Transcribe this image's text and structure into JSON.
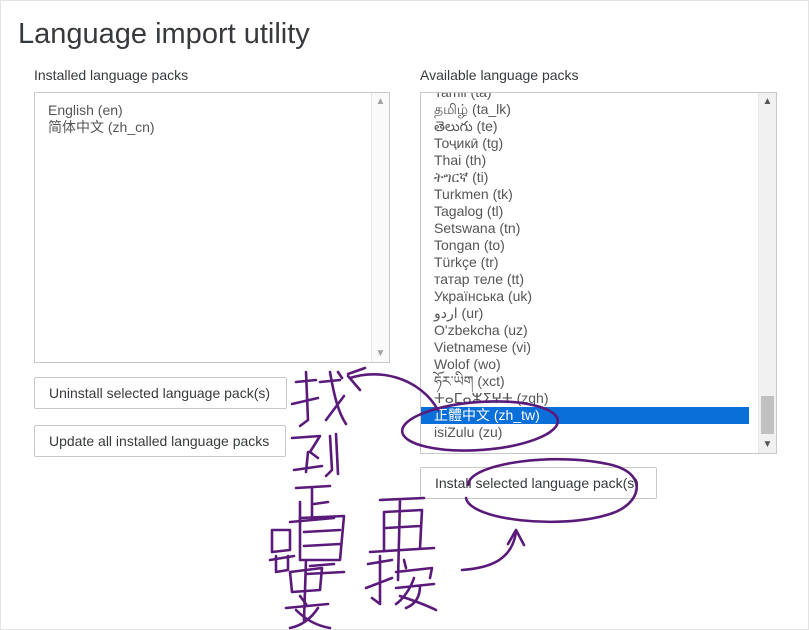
{
  "page": {
    "title": "Language import utility"
  },
  "installed": {
    "label": "Installed language packs",
    "items": [
      "English (en)",
      "简体中文 (zh_cn)"
    ]
  },
  "available": {
    "label": "Available language packs",
    "items": [
      "Tamil (ta)",
      "தமிழ் (ta_lk)",
      "తెలుగు (te)",
      "Тоҷикӣ (tg)",
      "Thai (th)",
      "ትግርኛ (ti)",
      "Turkmen (tk)",
      "Tagalog (tl)",
      "Setswana (tn)",
      "Tongan (to)",
      "Türkçe (tr)",
      "татар теле (tt)",
      "Українська (uk)",
      "اردو (ur)",
      "O'zbekcha (uz)",
      "Vietnamese (vi)",
      "Wolof (wo)",
      "ཧོར་ཡིག (xct)",
      "ⵜⴰⵎⴰⵣⵉⵖⵜ (zgh)",
      "正體中文 (zh_tw)",
      "isiZulu (zu)"
    ],
    "selected_index": 19
  },
  "buttons": {
    "uninstall": "Uninstall selected language pack(s)",
    "update": "Update all installed language packs",
    "install": "Install selected language pack(s)"
  },
  "annotation": {
    "color": "#5a1a7a",
    "handwriting_left": "找到正體中文",
    "handwriting_right": "再按"
  }
}
